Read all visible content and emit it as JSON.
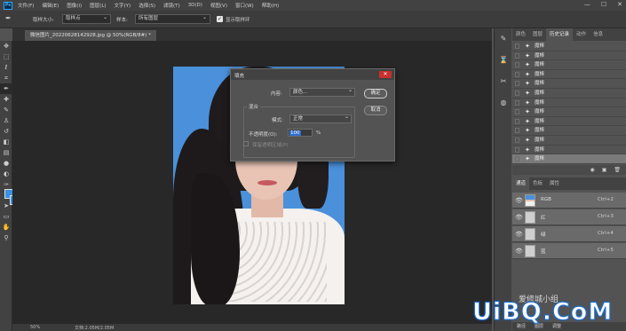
{
  "app": {
    "menu": [
      "文件(F)",
      "编辑(E)",
      "图像(I)",
      "图层(L)",
      "文字(Y)",
      "选择(S)",
      "滤镜(T)",
      "3D(D)",
      "视图(V)",
      "窗口(W)",
      "帮助(H)"
    ],
    "window_controls": [
      "—",
      "☐",
      "✕"
    ]
  },
  "options_bar": {
    "sample_size_label": "取样大小:",
    "sample_size_value": "取样点",
    "sample_label": "样本:",
    "sample_value": "所有图层",
    "show_ring_label": "显示取样环"
  },
  "document": {
    "tab_title": "微信图片_20220628142928.jpg @ 50%(RGB/8#) *",
    "zoom": "50%",
    "status_doc": "文档:2.05M/2.05M"
  },
  "fill_dialog": {
    "title": "填充",
    "content_label": "内容:",
    "content_value": "颜色...",
    "blending_label": "混合",
    "mode_label": "模式:",
    "mode_value": "正常",
    "opacity_label": "不透明度(O):",
    "opacity_value": "100",
    "opacity_unit": "%",
    "preserve_label": "保留透明区域(P)",
    "ok_label": "确定",
    "cancel_label": "取消"
  },
  "history_panel": {
    "tabs": [
      "颜色",
      "图层",
      "历史记录",
      "动作",
      "信息"
    ],
    "active_tab": "历史记录",
    "items": [
      {
        "label": "魔棒"
      },
      {
        "label": "魔棒"
      },
      {
        "label": "魔棒"
      },
      {
        "label": "魔棒"
      },
      {
        "label": "魔棒"
      },
      {
        "label": "魔棒"
      },
      {
        "label": "魔棒"
      },
      {
        "label": "魔棒"
      },
      {
        "label": "魔棒"
      },
      {
        "label": "魔棒"
      },
      {
        "label": "魔棒"
      },
      {
        "label": "魔棒"
      },
      {
        "label": "魔棒"
      }
    ],
    "selected_index": 12
  },
  "channels_panel": {
    "tabs": [
      "通道",
      "色板",
      "属性"
    ],
    "active_tab": "通道",
    "channels": [
      {
        "name": "RGB",
        "shortcut": "Ctrl+2"
      },
      {
        "name": "红",
        "shortcut": "Ctrl+3"
      },
      {
        "name": "绿",
        "shortcut": "Ctrl+4"
      },
      {
        "name": "蓝",
        "shortcut": "Ctrl+5"
      }
    ]
  },
  "bottom_tabs": [
    "路径",
    "图层",
    "调整"
  ],
  "watermark": {
    "brand": "UiBQ.CoM",
    "site_cn": "爱修城小组"
  },
  "colors": {
    "foreground": "#3a8fe0",
    "background": "#3a8fe0",
    "photo_background": "#4a90da"
  }
}
